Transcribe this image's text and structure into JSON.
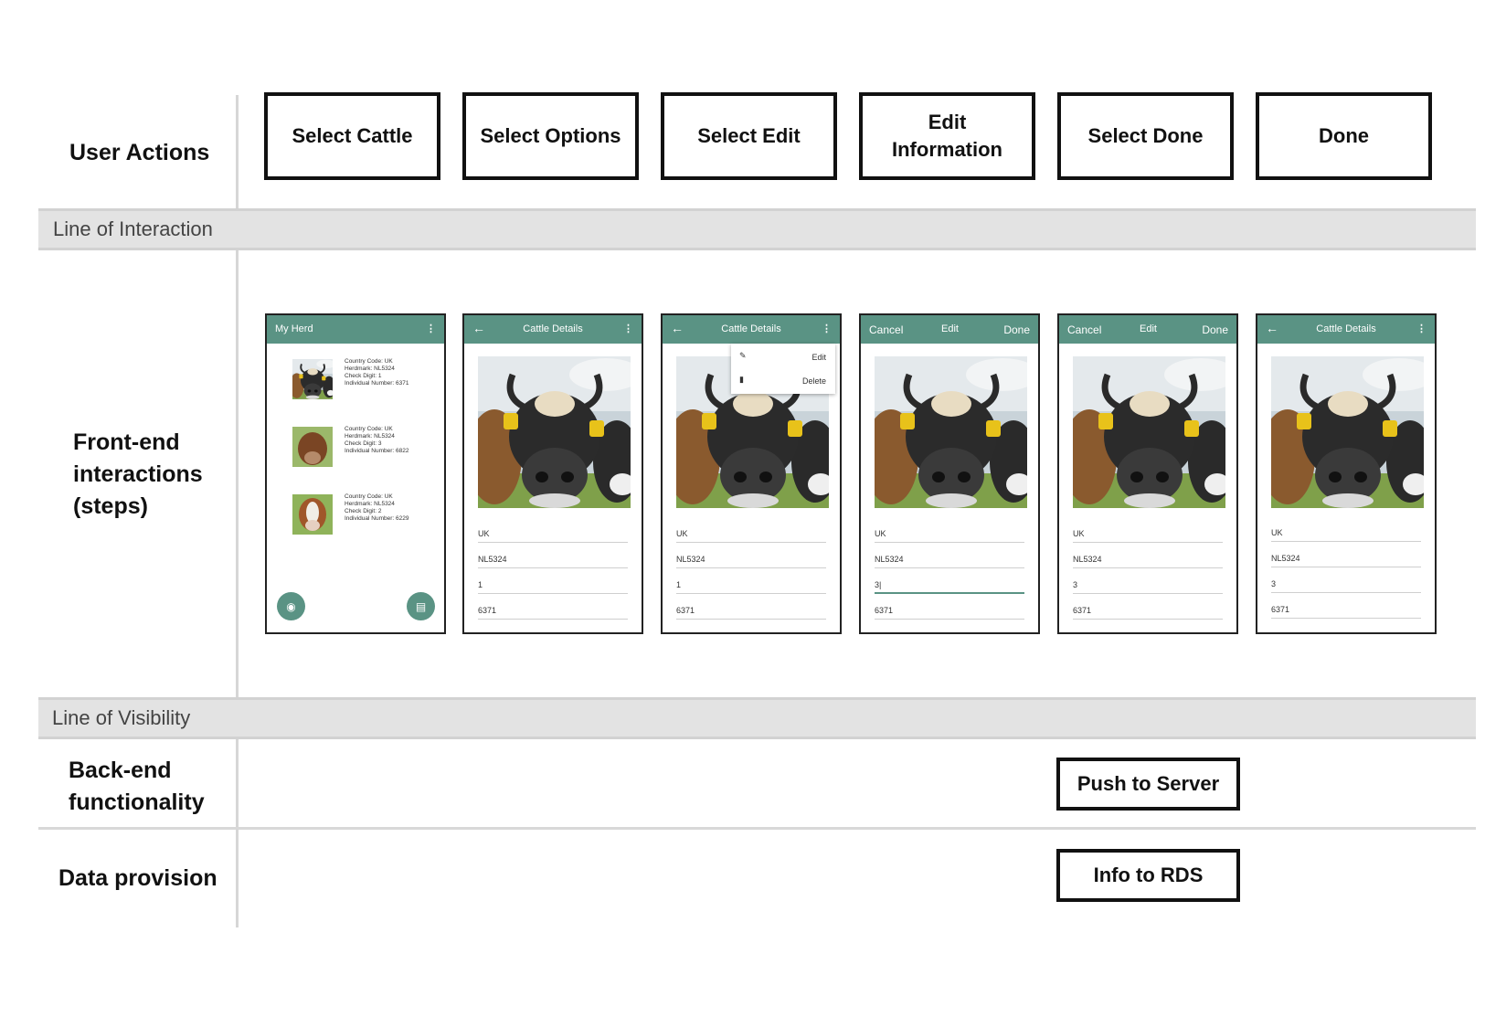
{
  "rows": {
    "user_actions": "User Actions",
    "line_of_interaction": "Line of Interaction",
    "frontend": "Front-end\ninteractions\n(steps)",
    "line_of_visibility": "Line of Visibility",
    "backend": "Back-end\nfunctionality",
    "data_provision": "Data provision"
  },
  "actions": [
    "Select Cattle",
    "Select Options",
    "Select Edit",
    "Edit\nInformation",
    "Select Done",
    "Done"
  ],
  "backend_box": "Push to Server",
  "data_box": "Info to RDS",
  "phones": {
    "my_herd": {
      "title": "My Herd",
      "items": [
        "Country Code: UK\nHerdmark: NL5324\nCheck Digit: 1\nIndividual Number: 6371",
        "Country Code: UK\nHerdmark: NL5324\nCheck Digit: 3\nIndividual Number: 6822",
        "Country Code: UK\nHerdmark: NL5324\nCheck Digit: 2\nIndividual Number: 6229"
      ]
    },
    "details_title": "Cattle Details",
    "edit_header": {
      "cancel": "Cancel",
      "title": "Edit",
      "done": "Done"
    },
    "menu": {
      "edit": "Edit",
      "delete": "Delete"
    },
    "fields_before": [
      "UK",
      "NL5324",
      "1",
      "6371"
    ],
    "fields_editing": [
      "UK",
      "NL5324",
      "3|",
      "6371"
    ],
    "fields_after": [
      "UK",
      "NL5324",
      "3",
      "6371"
    ]
  },
  "colors": {
    "appbar": "#5a9384",
    "band": "#e3e3e3",
    "border": "#111111"
  }
}
